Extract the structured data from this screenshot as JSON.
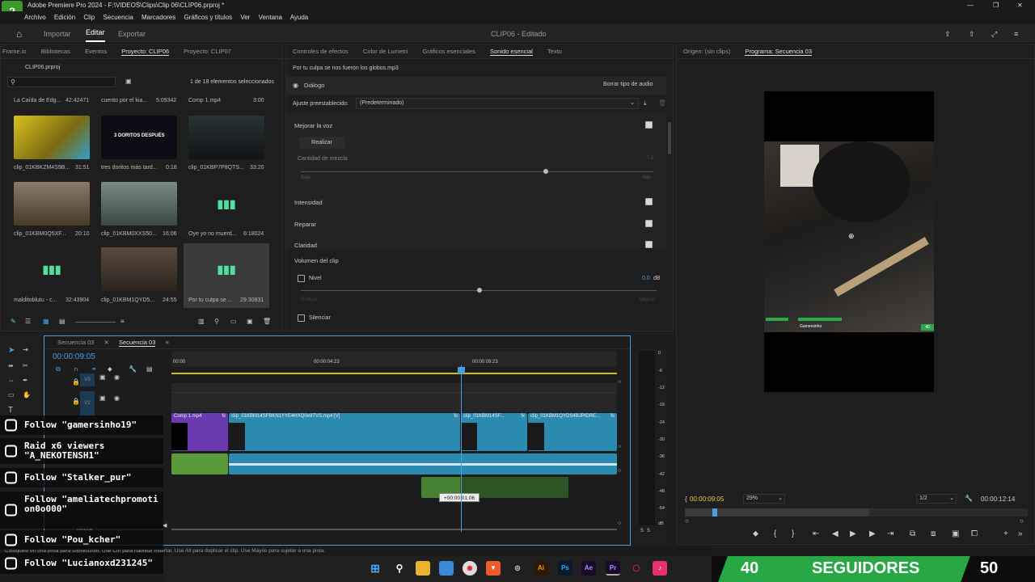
{
  "titlebar": {
    "title": "Adobe Premiere Pro 2024 - F:\\VIDEOS\\Clips\\Clip 06\\CLIP06.prproj *"
  },
  "menu": [
    "Archivo",
    "Edición",
    "Clip",
    "Secuencia",
    "Marcadores",
    "Gráficos y títulos",
    "Ver",
    "Ventana",
    "Ayuda"
  ],
  "appbar": {
    "home": "home-icon",
    "tabs": [
      "Importar",
      "Editar",
      "Exportar"
    ],
    "active_tab": "Editar",
    "project_title": "CLIP06 - Editado"
  },
  "project_panel": {
    "tabs": [
      "Frame.io",
      "Bibliotecas",
      "Eventos",
      "Proyecto: CLIP06",
      "Proyecto: CLIP07"
    ],
    "project_file": "CLIP06.prproj",
    "selection_count": "1 de 18 elementos seleccionados",
    "top_row": [
      {
        "name": "La Caída de Edg...",
        "dur": "42:42471"
      },
      {
        "name": "cuento por el kia...",
        "dur": "5:09342"
      },
      {
        "name": "Comp 1.mp4",
        "dur": "3:00"
      }
    ],
    "items": [
      {
        "name": "clip_01KBKZM4S9B...",
        "dur": "31:51",
        "color": "#b8a020"
      },
      {
        "name": "tres doritos más tard...",
        "dur": "0:18",
        "color": "#101018",
        "overlay": "3 DORITOS DESPUÉS"
      },
      {
        "name": "clip_01KBP7P8QTS...",
        "dur": "33:20",
        "color": "#1e2326"
      },
      {
        "name": "clip_01KBM0Q5XF...",
        "dur": "20:10",
        "color": "#6a5a4a"
      },
      {
        "name": "clip_01KBM0XXS50...",
        "dur": "16:06",
        "color": "#5a6a62"
      },
      {
        "name": "Oye yo no muerd...",
        "dur": "6:18024",
        "color": "audio"
      },
      {
        "name": "malditoblutu - c...",
        "dur": "32:43904",
        "color": "audio"
      },
      {
        "name": "clip_01KBM1QYD5...",
        "dur": "24:55",
        "color": "#4a4036"
      },
      {
        "name": "Por tu culpa se ...",
        "dur": "29:30831",
        "color": "audio"
      }
    ]
  },
  "essential_sound": {
    "tabs": [
      "Controles de efectos",
      "Color de Lumetri",
      "Gráficos esenciales",
      "Sonido esencial",
      "Texto"
    ],
    "active_tab": "Sonido esencial",
    "file": "Por tu culpa se nos fueron los globos.mp3",
    "type_label": "Diálogo",
    "clear_button": "Borrar tipo de audio",
    "preset_label": "Ajuste preestablecido:",
    "preset_value": "(Predeterminado)",
    "sections": {
      "enhance": "Mejorar la voz",
      "apply": "Realizar",
      "mix_amount": "Cantidad de mezcla",
      "mix_low": "Bajo",
      "mix_high": "Alto",
      "mix_value": "7.0",
      "loudness": "Intensidad",
      "repair": "Reparar",
      "clarity": "Claridad",
      "clip_volume": "Volumen del clip",
      "level": "Nivel",
      "level_value": "0.0",
      "level_unit": "dB",
      "level_low": "Reducir",
      "level_high": "Mejorar",
      "mute": "Silenciar"
    }
  },
  "program_monitor": {
    "tabs": [
      "Origen: (sin clips)",
      "Programa: Secuencia 03"
    ],
    "hud_player": "Gamersinho",
    "hud_fps": "40",
    "timecode": "00:00:09:05",
    "zoom": "29%",
    "quality": "1/2",
    "duration": "00:00:12:14"
  },
  "timeline": {
    "tabs": [
      "Secuencia 03",
      "Secuencia 03"
    ],
    "timecode": "00:00:09:05",
    "ruler": [
      "00:00",
      "00:00:04:23",
      "00:00:09:23"
    ],
    "tracks": [
      "V3",
      "V2"
    ],
    "clips_v": [
      "Comp 1.mp4",
      "clip_01KBM14SFBKN1YYE4HXQ0e9TVS.mp4 [V]",
      "clip_01KBM14SF...",
      "clip_01KBM1QYDS4BJPIDRE..."
    ],
    "drag_tooltip": "+00:00:01:06",
    "bottom_label": "Mezcla",
    "meter_ticks": [
      "0",
      "-6",
      "-12",
      "-18",
      "-24",
      "-30",
      "-36",
      "-42",
      "-48",
      "-54",
      "dB"
    ],
    "meter_labels": [
      "S",
      "S"
    ]
  },
  "status_bar": "Colóquelo en una pista para sobrescribir. Use Ctrl para habilitar Insertar. Use Alt para duplicar el clip. Use Mayús para sujetar a una pista.",
  "overlay": {
    "follows": [
      "Follow \"gamersinho19\"",
      "Raid x6 viewers \"A_NEKOTENSH1\"",
      "Follow \"Stalker_pur\"",
      "Follow \"ameliatechpromotion0o000\"",
      "Follow \"Pou_kcher\"",
      "Follow \"Lucianoxd231245\""
    ],
    "goal_left": "40",
    "goal_label": "SEGUIDORES",
    "goal_right": "50"
  },
  "colors": {
    "accent": "#2a8ab0",
    "audio": "#3c7a54",
    "playhead": "#4a9ee0",
    "goal_green": "#28a745"
  }
}
